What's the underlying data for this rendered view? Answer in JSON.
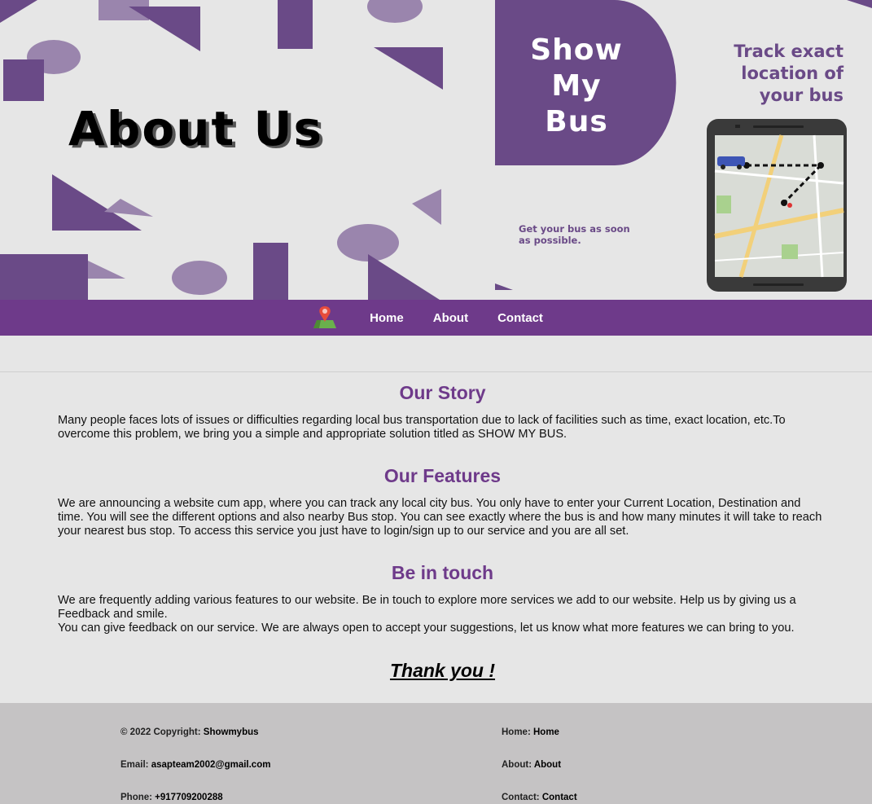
{
  "hero": {
    "title": "About Us",
    "brand_lines": [
      "Show",
      "My",
      "Bus"
    ],
    "track_lines": [
      "Track exact",
      "location of",
      "your bus"
    ],
    "tagline_lines": [
      "Get your bus as soon",
      "as possible."
    ],
    "colors": {
      "purple": "#6a4a87",
      "light_purple": "#9a85ad",
      "background": "#e6e6e6"
    }
  },
  "nav": {
    "logo_icon": "map-pin-icon",
    "items": [
      {
        "label": "Home"
      },
      {
        "label": "About"
      },
      {
        "label": "Contact"
      }
    ],
    "background": "#6e3a8a"
  },
  "sections": [
    {
      "title": "Our Story",
      "paragraphs": [
        "Many people faces lots of issues or difficulties regarding local bus transportation due to lack of facilities such as time, exact location, etc.To overcome this problem, we bring you a simple and appropriate solution titled as SHOW MY BUS."
      ]
    },
    {
      "title": "Our Features",
      "paragraphs": [
        "We are announcing a website cum app, where you can track any local city bus. You only have to enter your Current Location, Destination and time. You will see the different options and also nearby Bus stop. You can see exactly where the bus is and how many minutes it will take to reach your nearest bus stop. To access this service you just have to login/sign up to our service and you are all set."
      ]
    },
    {
      "title": "Be in touch",
      "paragraphs": [
        "We are frequently adding various features to our website. Be in touch to explore more services we add to our website. Help us by giving us a Feedback and smile.",
        "You can give feedback on our service. We are always open to accept your suggestions, let us know what more features we can bring to you."
      ]
    }
  ],
  "thanks": "Thank you !",
  "footer": {
    "left": [
      {
        "label": "© 2022 Copyright: ",
        "value": "Showmybus"
      },
      {
        "label": "Email: ",
        "value": "asapteam2002@gmail.com"
      },
      {
        "label": "Phone: ",
        "value": "+917709200288"
      }
    ],
    "right": [
      {
        "label": "Home: ",
        "value": "Home"
      },
      {
        "label": "About: ",
        "value": "About"
      },
      {
        "label": "Contact: ",
        "value": "Contact"
      }
    ],
    "background": "#c5c3c4"
  }
}
